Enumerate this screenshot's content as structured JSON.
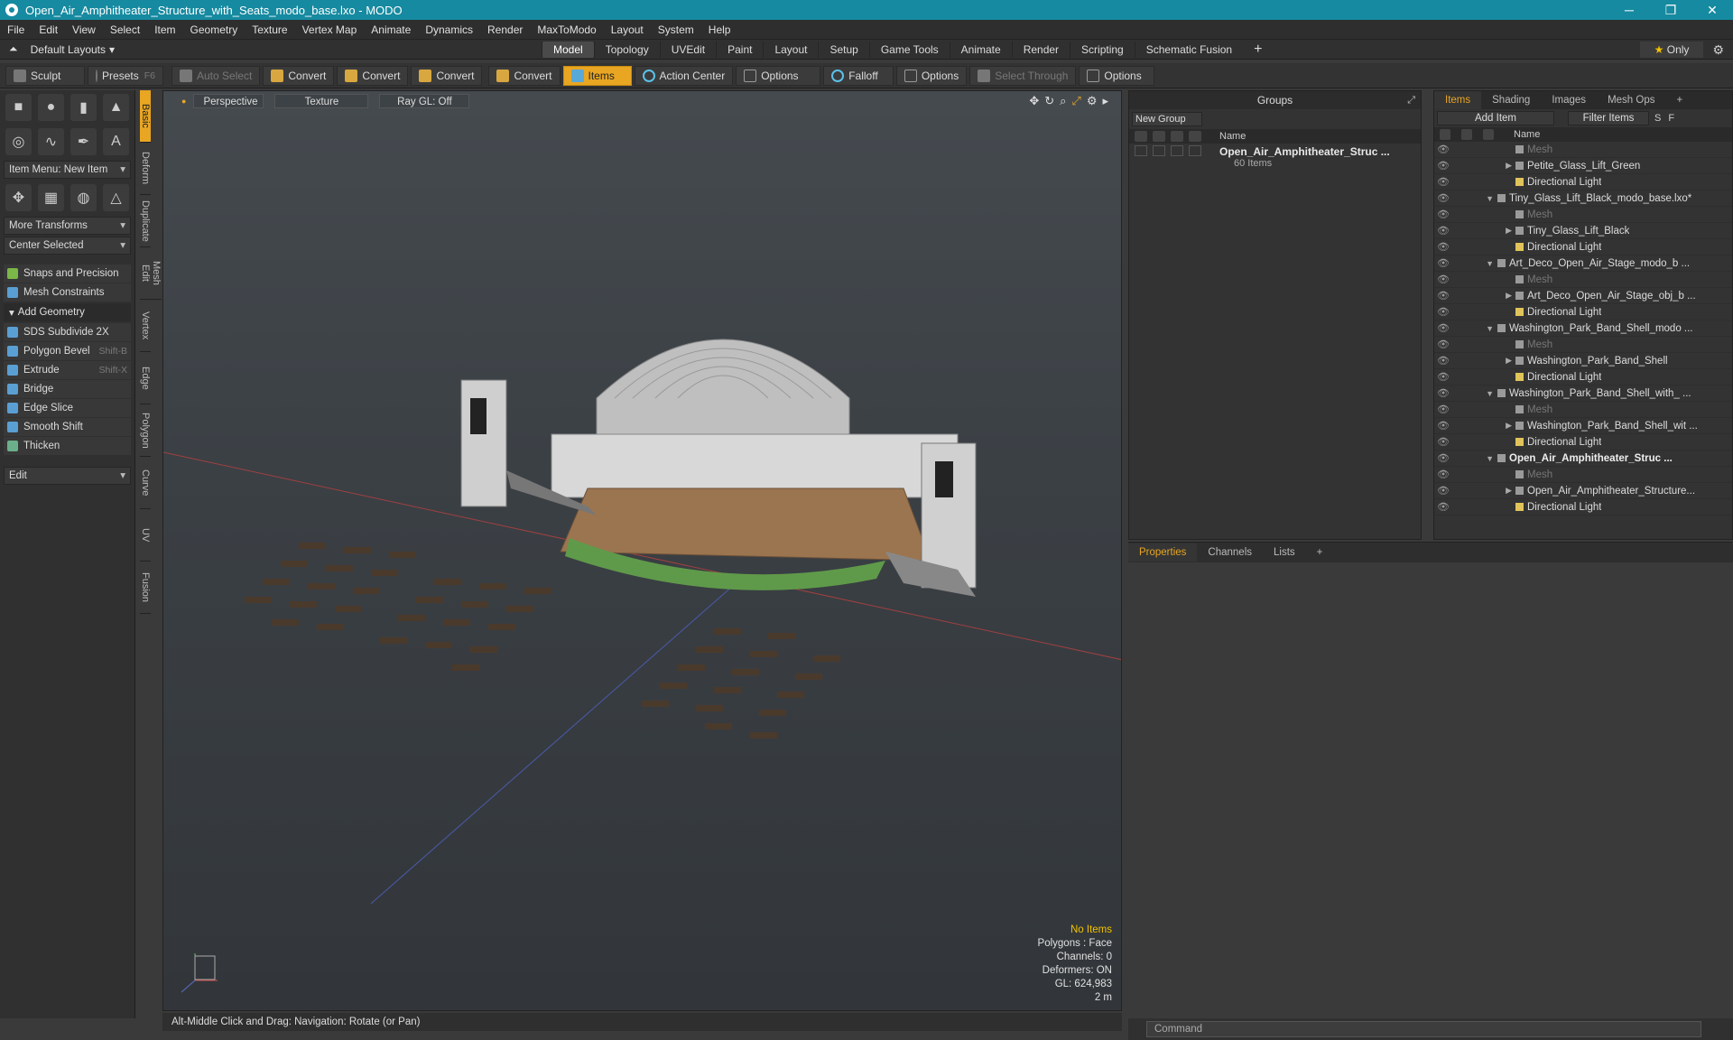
{
  "window": {
    "title": "Open_Air_Amphitheater_Structure_with_Seats_modo_base.lxo - MODO"
  },
  "menu": [
    "File",
    "Edit",
    "View",
    "Select",
    "Item",
    "Geometry",
    "Texture",
    "Vertex Map",
    "Animate",
    "Dynamics",
    "Render",
    "MaxToModo",
    "Layout",
    "System",
    "Help"
  ],
  "layout": {
    "default_label": "Default Layouts",
    "tabs": [
      "Model",
      "Topology",
      "UVEdit",
      "Paint",
      "Layout",
      "Setup",
      "Game Tools",
      "Animate",
      "Render",
      "Scripting",
      "Schematic Fusion"
    ],
    "active_tab": "Model",
    "only_label": "Only"
  },
  "toolbar": {
    "sculpt": "Sculpt",
    "presets": "Presets",
    "presets_key": "F6",
    "auto_select": "Auto Select",
    "convert1": "Convert",
    "convert2": "Convert",
    "convert3": "Convert",
    "convert4": "Convert",
    "items": "Items",
    "action_center": "Action Center",
    "options1": "Options",
    "falloff": "Falloff",
    "options2": "Options",
    "select_through": "Select Through",
    "options3": "Options"
  },
  "left": {
    "item_menu": "Item Menu: New Item",
    "more_transforms": "More Transforms",
    "center_selected": "Center Selected",
    "snaps": "Snaps and Precision",
    "mesh_constraints": "Mesh Constraints",
    "add_geometry": "Add Geometry",
    "sds": "SDS Subdivide 2X",
    "polygon_bevel": "Polygon Bevel",
    "polygon_bevel_key": "Shift-B",
    "extrude": "Extrude",
    "extrude_key": "Shift-X",
    "bridge": "Bridge",
    "edge_slice": "Edge Slice",
    "smooth_shift": "Smooth Shift",
    "thicken": "Thicken",
    "edit": "Edit",
    "side_tabs": [
      "Basic",
      "Deform",
      "Duplicate",
      "Mesh Edit",
      "Vertex",
      "Edge",
      "Polygon",
      "Curve",
      "UV",
      "Fusion"
    ]
  },
  "viewport": {
    "perspective": "Perspective",
    "texture": "Texture",
    "raygl": "Ray GL: Off",
    "info_items": "No Items",
    "info_polys": "Polygons : Face",
    "info_channels": "Channels: 0",
    "info_deformers": "Deformers: ON",
    "info_gl": "GL: 624,983",
    "info_scale": "2 m"
  },
  "status": "Alt-Middle Click and Drag:   Navigation: Rotate (or Pan)",
  "groups": {
    "title": "Groups",
    "new_group": "New Group",
    "name_col": "Name",
    "group_name": "Open_Air_Amphitheater_Struc ...",
    "group_count": "60 Items"
  },
  "items_panel": {
    "tabs": [
      "Items",
      "Shading",
      "Images",
      "Mesh Ops"
    ],
    "add_item": "Add Item",
    "filter": "Filter Items",
    "name_col": "Name",
    "rows": [
      {
        "label": "Mesh",
        "kind": "mesh"
      },
      {
        "label": "Petite_Glass_Lift_Green",
        "kind": "item"
      },
      {
        "label": "Directional Light",
        "kind": "light"
      },
      {
        "label": "Tiny_Glass_Lift_Black_modo_base.lxo*",
        "kind": "scene"
      },
      {
        "label": "Mesh",
        "kind": "mesh"
      },
      {
        "label": "Tiny_Glass_Lift_Black",
        "kind": "item"
      },
      {
        "label": "Directional Light",
        "kind": "light"
      },
      {
        "label": "Art_Deco_Open_Air_Stage_modo_b ...",
        "kind": "scene"
      },
      {
        "label": "Mesh",
        "kind": "mesh"
      },
      {
        "label": "Art_Deco_Open_Air_Stage_obj_b ...",
        "kind": "item"
      },
      {
        "label": "Directional Light",
        "kind": "light"
      },
      {
        "label": "Washington_Park_Band_Shell_modo ...",
        "kind": "scene"
      },
      {
        "label": "Mesh",
        "kind": "mesh"
      },
      {
        "label": "Washington_Park_Band_Shell",
        "kind": "item"
      },
      {
        "label": "Directional Light",
        "kind": "light"
      },
      {
        "label": "Washington_Park_Band_Shell_with_ ...",
        "kind": "scene"
      },
      {
        "label": "Mesh",
        "kind": "mesh"
      },
      {
        "label": "Washington_Park_Band_Shell_wit ...",
        "kind": "item"
      },
      {
        "label": "Directional Light",
        "kind": "light"
      },
      {
        "label": "Open_Air_Amphitheater_Struc ...",
        "kind": "scene-bold"
      },
      {
        "label": "Mesh",
        "kind": "mesh"
      },
      {
        "label": "Open_Air_Amphitheater_Structure...",
        "kind": "item"
      },
      {
        "label": "Directional Light",
        "kind": "light"
      }
    ]
  },
  "props": {
    "tabs": [
      "Properties",
      "Channels",
      "Lists"
    ]
  },
  "command": {
    "placeholder": "Command"
  },
  "colors": {
    "accent": "#e8a623",
    "titlebar": "#168aa0"
  }
}
